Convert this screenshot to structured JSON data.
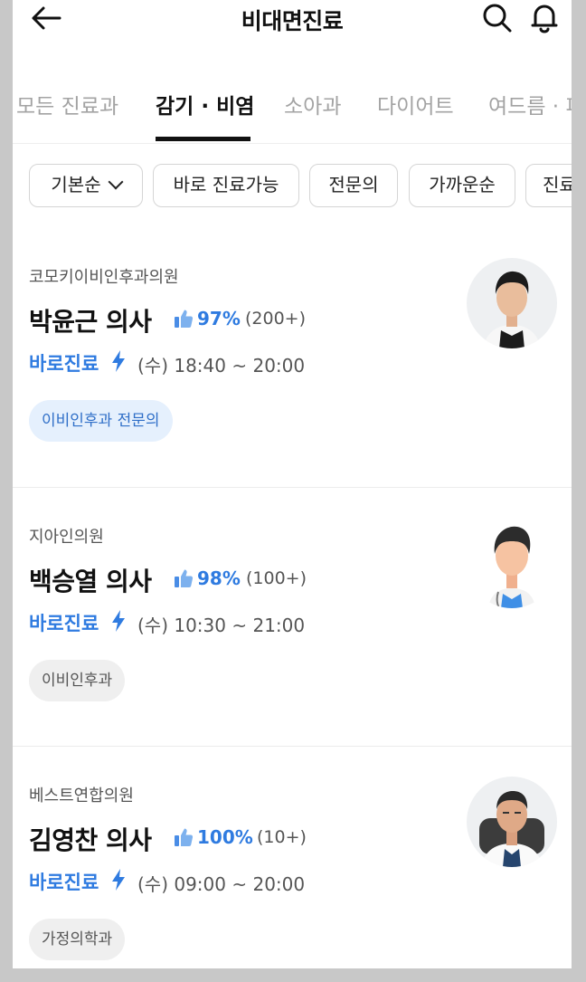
{
  "header": {
    "title": "비대면진료"
  },
  "tabs": [
    "모든 진료과",
    "감기 · 비염",
    "소아과",
    "다이어트",
    "여드름 · 피"
  ],
  "active_tab": 1,
  "filters": [
    "기본순",
    "바로 진료가능",
    "전문의",
    "가까운순",
    "진료남"
  ],
  "doctors": [
    {
      "clinic": "코모키이비인후과의원",
      "name": "박윤근 의사",
      "rating": "97%",
      "reviews": "(200+)",
      "badge": "바로진료",
      "hours": "(수) 18:40 ~ 20:00",
      "tag": "이비인후과 전문의",
      "tag_style": "blue"
    },
    {
      "clinic": "지아인의원",
      "name": "백승열 의사",
      "rating": "98%",
      "reviews": "(100+)",
      "badge": "바로진료",
      "hours": "(수) 10:30 ~ 21:00",
      "tag": "이비인후과",
      "tag_style": "gray"
    },
    {
      "clinic": "베스트연합의원",
      "name": "김영찬 의사",
      "rating": "100%",
      "reviews": "(10+)",
      "badge": "바로진료",
      "hours": "(수) 09:00 ~ 20:00",
      "tag": "가정의학과",
      "tag_style": "gray"
    }
  ],
  "colors": {
    "accent": "#2f7be0",
    "tag_blue_bg": "#e5f0fd",
    "tag_gray_bg": "#efefef"
  },
  "icons": [
    "back-arrow-icon",
    "search-icon",
    "bell-icon",
    "chevron-down-icon",
    "thumbs-up-icon",
    "lightning-bolt-icon"
  ]
}
